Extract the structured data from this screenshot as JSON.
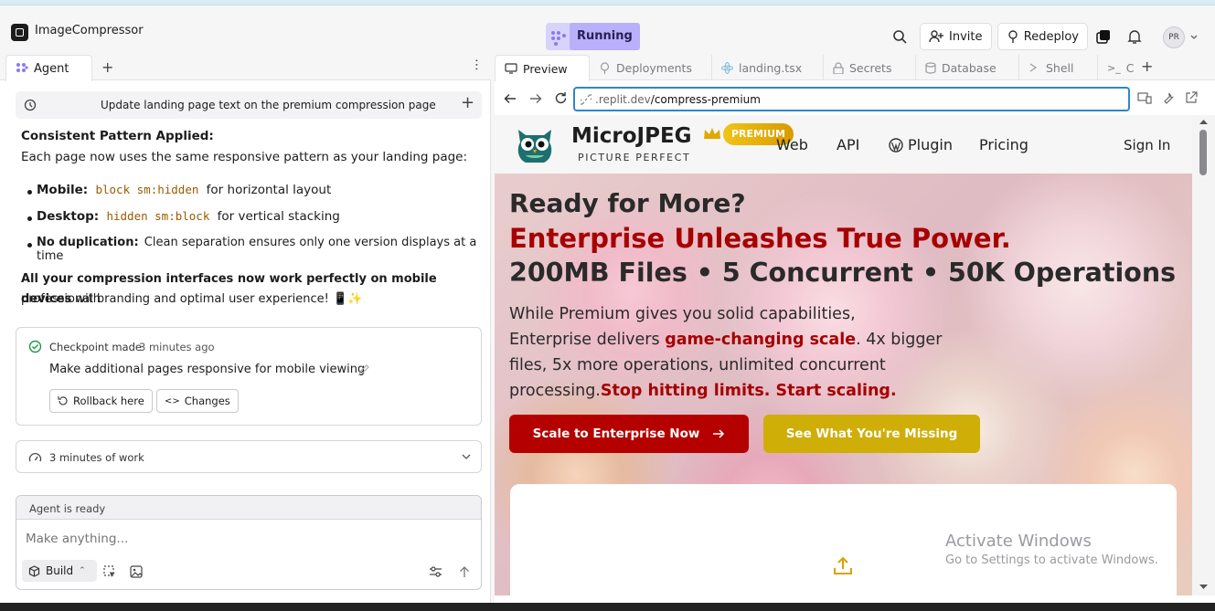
{
  "header": {
    "app_name": "ImageCompressor",
    "status": "Running",
    "invite_label": "Invite",
    "redeploy_label": "Redeploy",
    "avatar_initials": "PR"
  },
  "left": {
    "tab_label": "Agent",
    "session_title": "Update landing page text on the premium compression page",
    "heading": "Consistent Pattern Applied:",
    "intro": "Each page now uses the same responsive pattern as your landing page:",
    "bullets": [
      {
        "label": "Mobile:",
        "code": "block sm:hidden",
        "rest": "for horizontal layout"
      },
      {
        "label": "Desktop:",
        "code": "hidden sm:block",
        "rest": "for vertical stacking"
      },
      {
        "label": "No duplication:",
        "code": "",
        "rest": "Clean separation ensures only one version displays at a time"
      }
    ],
    "summary_bold": "All your compression interfaces now work perfectly on mobile devices",
    "summary_rest": " with",
    "summary_line2": "professional branding and optimal user experience! 📱✨",
    "checkpoint_label": "Checkpoint made",
    "checkpoint_time": "3 minutes ago",
    "checkpoint_desc": "Make additional pages responsive for mobile viewing",
    "rollback_label": "Rollback here",
    "changes_label": "Changes",
    "work_label": "3 minutes of work",
    "agent_status": "Agent is ready",
    "input_placeholder": "Make anything...",
    "build_label": "Build"
  },
  "right": {
    "tabs": [
      "Preview",
      "Deployments",
      "landing.tsx",
      "Secrets",
      "Database",
      "Shell",
      "C"
    ],
    "url_prefix": ".replit.dev",
    "url_path": "/compress-premium",
    "site": {
      "brand": "MicroJPEG",
      "badge": "PREMIUM",
      "tagline": "PICTURE PERFECT",
      "nav": [
        "Web",
        "API",
        "Plugin",
        "Pricing"
      ],
      "signin": "Sign In",
      "h1": "Ready for More?",
      "h2": "Enterprise Unleashes True Power.",
      "h3": "200MB Files • 5 Concurrent • 50K Operations",
      "p1": "While Premium gives you solid capabilities,",
      "p2a": "Enterprise delivers ",
      "p2b": "game-changing scale",
      "p2c": ". 4x bigger",
      "p3": "files, 5x more operations, unlimited concurrent",
      "p4a": "processing.",
      "p4b": "Stop hitting limits. Start scaling.",
      "cta_primary": "Scale to Enterprise Now",
      "cta_secondary": "See What You're Missing",
      "watermark_title": "Activate Windows",
      "watermark_sub": "Go to Settings to activate Windows."
    }
  },
  "colors": {
    "accent_red": "#b50000",
    "accent_gold": "#cfae08",
    "running_bg": "#b9affa"
  }
}
